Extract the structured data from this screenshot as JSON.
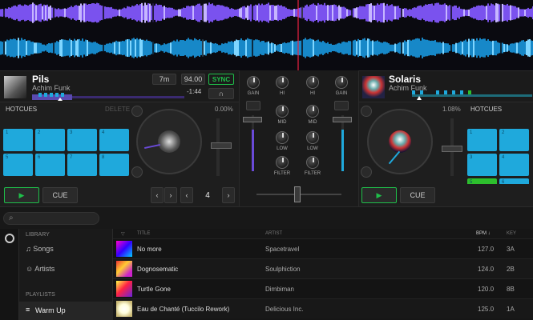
{
  "deck_left": {
    "title": "Pils",
    "artist": "Achim Funk",
    "time_total": "7m",
    "bpm": "94.00",
    "sync_label": "SYNC",
    "time_remaining": "-1:44",
    "pitch": "0.00%",
    "hotcues_label": "HOTCUES",
    "delete_label": "DELETE",
    "pads": [
      "1",
      "2",
      "3",
      "4",
      "5",
      "6",
      "7",
      "8"
    ],
    "play_icon": "▶",
    "cue_label": "CUE",
    "loop_value": "4",
    "colors": {
      "pad": "#1fa9dc",
      "play": "#1fbf4a"
    }
  },
  "deck_right": {
    "title": "Solaris",
    "artist": "Achim Funk",
    "pitch": "1.08%",
    "hotcues_label": "HOTCUES",
    "pads": [
      "1",
      "2",
      "3",
      "4",
      "5",
      "6"
    ],
    "play_icon": "▶",
    "cue_label": "CUE",
    "colors": {
      "pad": "#1fa9dc",
      "green_pad": "#2dbf2d"
    }
  },
  "mixer": {
    "left_col": [
      "GAIN"
    ],
    "center_left": [
      "HI",
      "MID",
      "LOW",
      "FILTER"
    ],
    "center_right": [
      "HI",
      "MID",
      "LOW",
      "FILTER"
    ],
    "right_col": [
      "GAIN"
    ]
  },
  "library": {
    "section_library": "LIBRARY",
    "songs": "Songs",
    "artists": "Artists",
    "section_playlists": "PLAYLISTS",
    "playlist_active": "Warm Up",
    "headers": {
      "title": "TITLE",
      "artist": "ARTIST",
      "bpm": "BPM ↓",
      "key": "KEY"
    },
    "rows": [
      {
        "title": "No more",
        "artist": "Spacetravel",
        "bpm": "127.0",
        "key": "3A"
      },
      {
        "title": "Dognosematic",
        "artist": "Soulphiction",
        "bpm": "124.0",
        "key": "2B"
      },
      {
        "title": "Turtle Gone",
        "artist": "Dimbiman",
        "bpm": "120.0",
        "key": "8B"
      },
      {
        "title": "Eau de Chanté (Tuccilo Rework)",
        "artist": "Delicious Inc.",
        "bpm": "125.0",
        "key": "1A"
      }
    ]
  }
}
